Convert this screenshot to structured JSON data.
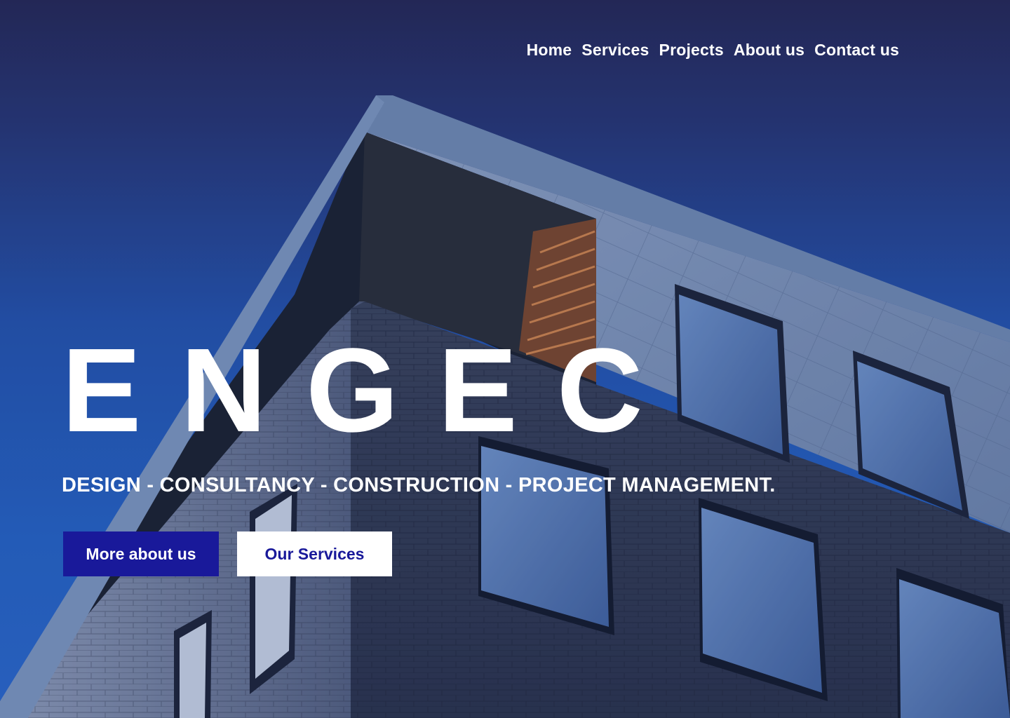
{
  "nav": {
    "items": [
      {
        "label": "Home"
      },
      {
        "label": "Services"
      },
      {
        "label": "Projects"
      },
      {
        "label": "About us"
      },
      {
        "label": "Contact us"
      }
    ]
  },
  "hero": {
    "brand": "ENGEC",
    "tagline": "DESIGN - CONSULTANCY - CONSTRUCTION - PROJECT MANAGEMENT.",
    "primary_button": "More about us",
    "secondary_button": "Our Services"
  },
  "colors": {
    "sky_top": "#25254f",
    "sky_bottom": "#2a64c4",
    "primary_button_bg": "#19199a",
    "secondary_button_bg": "#ffffff",
    "text": "#ffffff"
  }
}
